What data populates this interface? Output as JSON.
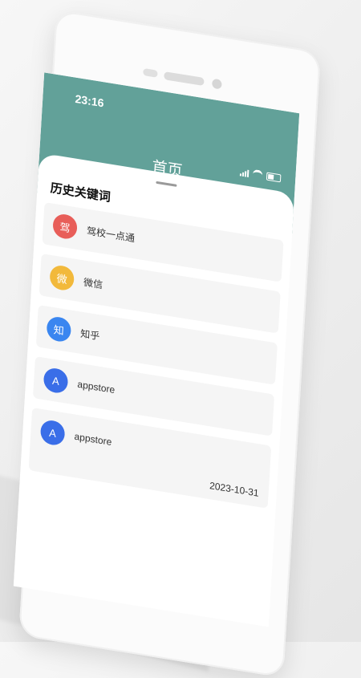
{
  "status_bar": {
    "time": "23:16"
  },
  "appbar": {
    "title": "首页"
  },
  "section": {
    "title": "历史关键词"
  },
  "items": [
    {
      "icon": "驾",
      "icon_color": "#e85e59",
      "label": "驾校一点通"
    },
    {
      "icon": "微",
      "icon_color": "#f2b93b",
      "label": "微信"
    },
    {
      "icon": "知",
      "icon_color": "#3a86f0",
      "label": "知乎"
    },
    {
      "icon": "A",
      "icon_color": "#3a6ee8",
      "label": "appstore"
    },
    {
      "icon": "A",
      "icon_color": "#3a6ee8",
      "label": "appstore",
      "date": "2023-10-31"
    }
  ],
  "colors": {
    "accent": "#62a199"
  }
}
